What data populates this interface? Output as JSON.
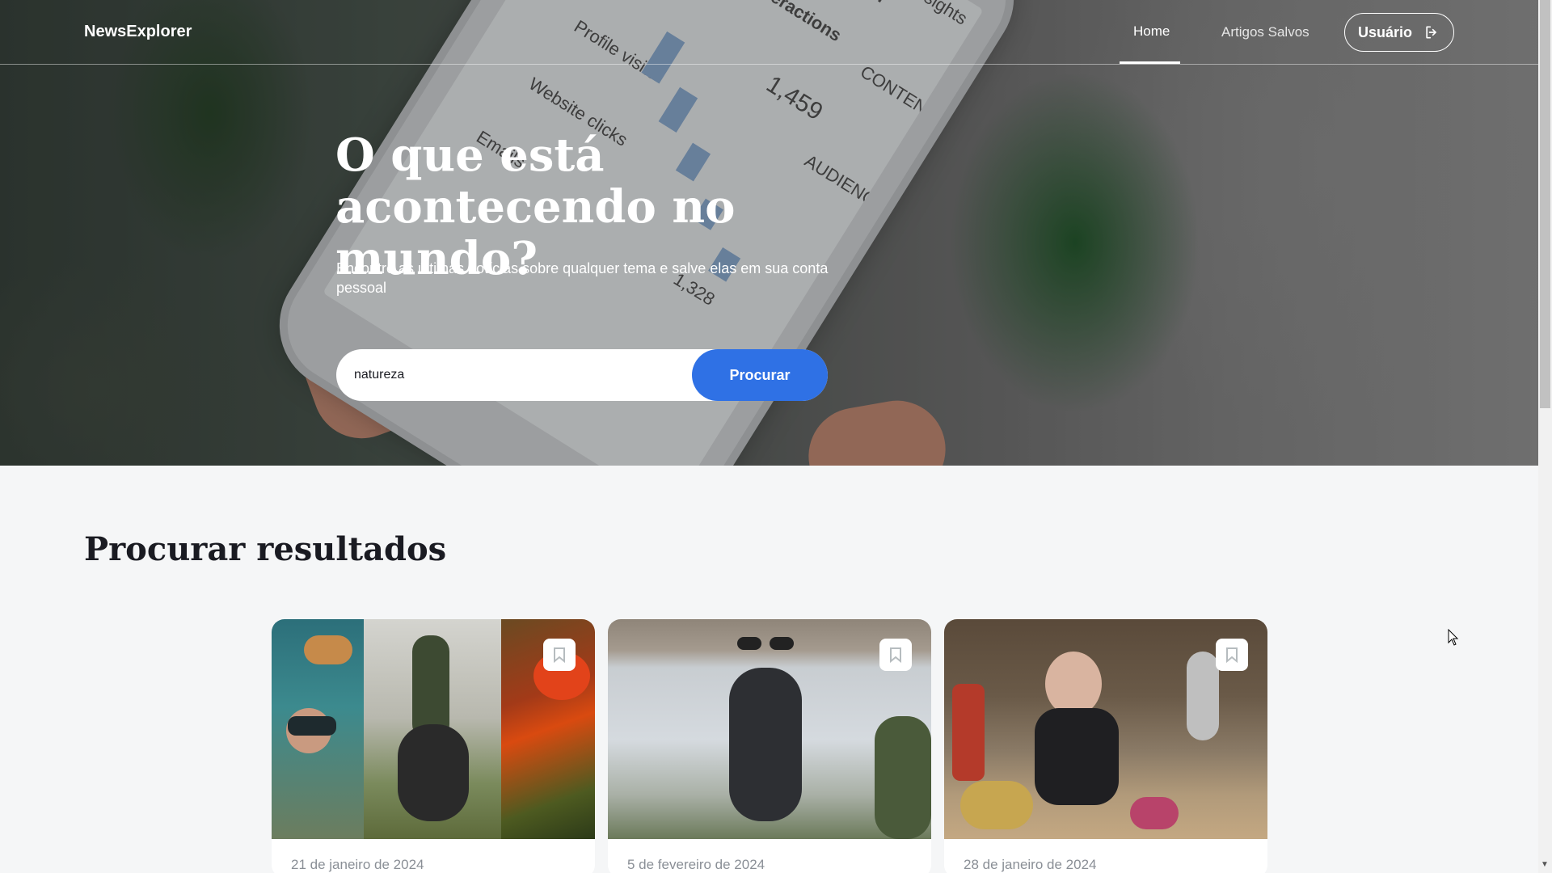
{
  "header": {
    "logo": "NewsExplorer",
    "nav_home": "Home",
    "nav_saved": "Artigos Salvos",
    "user_button": "Usuário"
  },
  "hero": {
    "title": "O que está acontecendo no mundo?",
    "subtitle": "Encontre as últimas notícias sobre qualquer tema e salve elas em sua conta pessoal",
    "search_value": "natureza",
    "search_button": "Procurar"
  },
  "results": {
    "title": "Procurar resultados",
    "cards": [
      {
        "date": "21 de janeiro de 2024",
        "icon": "bookmark-icon"
      },
      {
        "date": "5 de fevereiro de 2024",
        "icon": "bookmark-icon"
      },
      {
        "date": "28 de janeiro de 2024",
        "icon": "bookmark-icon"
      }
    ]
  },
  "colors": {
    "accent": "#2f71e5",
    "text_dark": "#1a1b22",
    "date_gray": "#8a8f96",
    "page_bg": "#f5f6f7"
  }
}
